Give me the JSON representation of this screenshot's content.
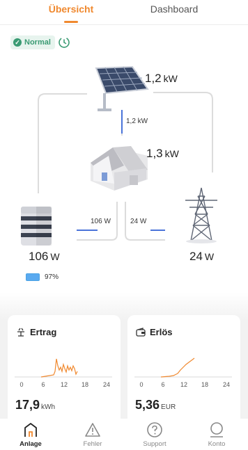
{
  "tabs": [
    {
      "label": "Übersicht",
      "active": true
    },
    {
      "label": "Dashboard",
      "active": false
    }
  ],
  "status": {
    "label": "Normal",
    "color": "#3a9b73"
  },
  "flow": {
    "solar": {
      "value": "1,2",
      "unit": "kW",
      "line_label": "1,2 kW"
    },
    "house": {
      "value": "1,3",
      "unit": "kW"
    },
    "battery": {
      "value": "106",
      "unit": "W",
      "line_label": "106 W",
      "soc": "97%",
      "soc_fraction": 0.97
    },
    "grid": {
      "value": "24",
      "unit": "W",
      "line_label": "24 W"
    }
  },
  "cards": {
    "yield": {
      "title": "Ertrag",
      "value": "17,9",
      "unit": "kWh",
      "x_ticks": [
        "0",
        "6",
        "12",
        "18",
        "24"
      ]
    },
    "revenue": {
      "title": "Erlös",
      "value": "5,36",
      "unit": "EUR",
      "x_ticks": [
        "0",
        "6",
        "12",
        "18",
        "24"
      ]
    }
  },
  "nav": [
    {
      "label": "Anlage",
      "icon": "home-icon",
      "active": true
    },
    {
      "label": "Fehler",
      "icon": "warning-icon",
      "active": false
    },
    {
      "label": "Support",
      "icon": "help-icon",
      "active": false
    },
    {
      "label": "Konto",
      "icon": "account-icon",
      "active": false
    }
  ],
  "colors": {
    "accent": "#f0892f",
    "flow_line": "#4a73d9",
    "battery": "#5aaaf0",
    "chart": "#f0892f"
  }
}
